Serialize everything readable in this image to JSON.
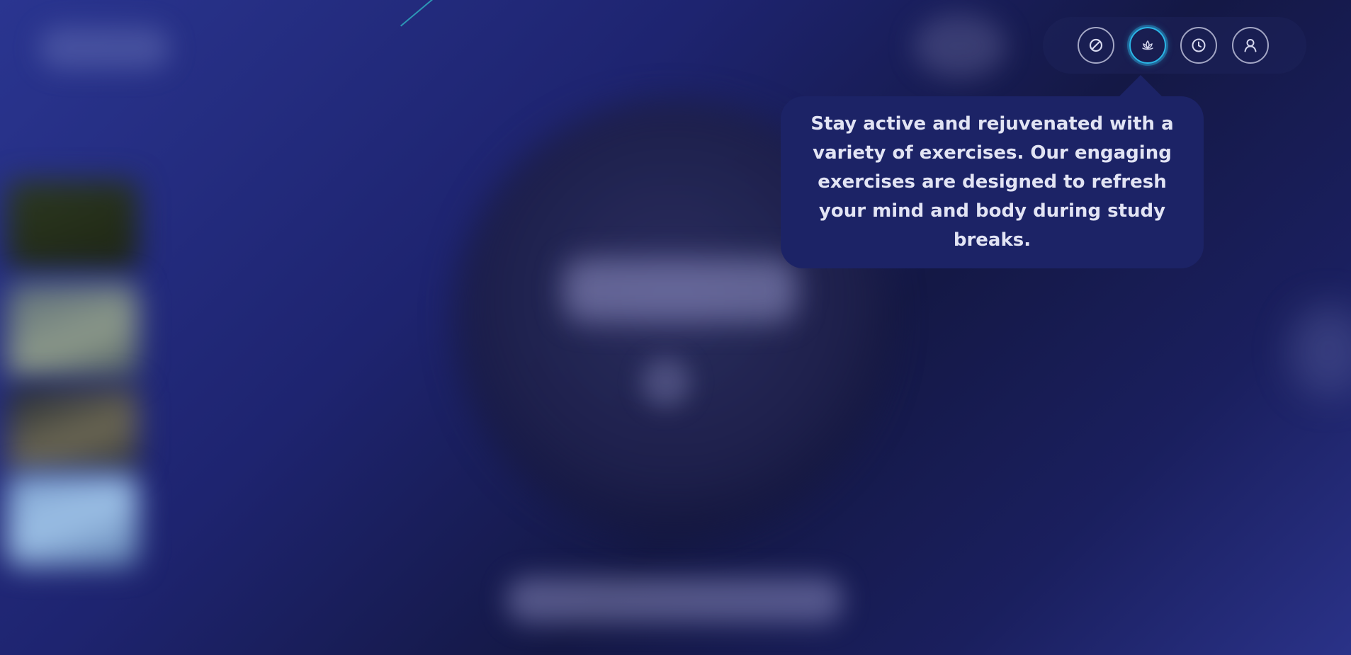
{
  "nav": {
    "items": [
      {
        "name": "block",
        "icon": "block-icon"
      },
      {
        "name": "exercises",
        "icon": "lotus-icon",
        "active": true
      },
      {
        "name": "history",
        "icon": "clock-icon"
      },
      {
        "name": "profile",
        "icon": "user-icon"
      }
    ],
    "accent_color": "#2bb7e8"
  },
  "tooltip": {
    "text": "Stay active and rejuvenated with a variety of exercises. Our engaging exercises are designed to refresh your mind and body during study breaks."
  },
  "colors": {
    "tooltip_bg": "#1c2366",
    "tooltip_text": "#e2e4f4"
  }
}
